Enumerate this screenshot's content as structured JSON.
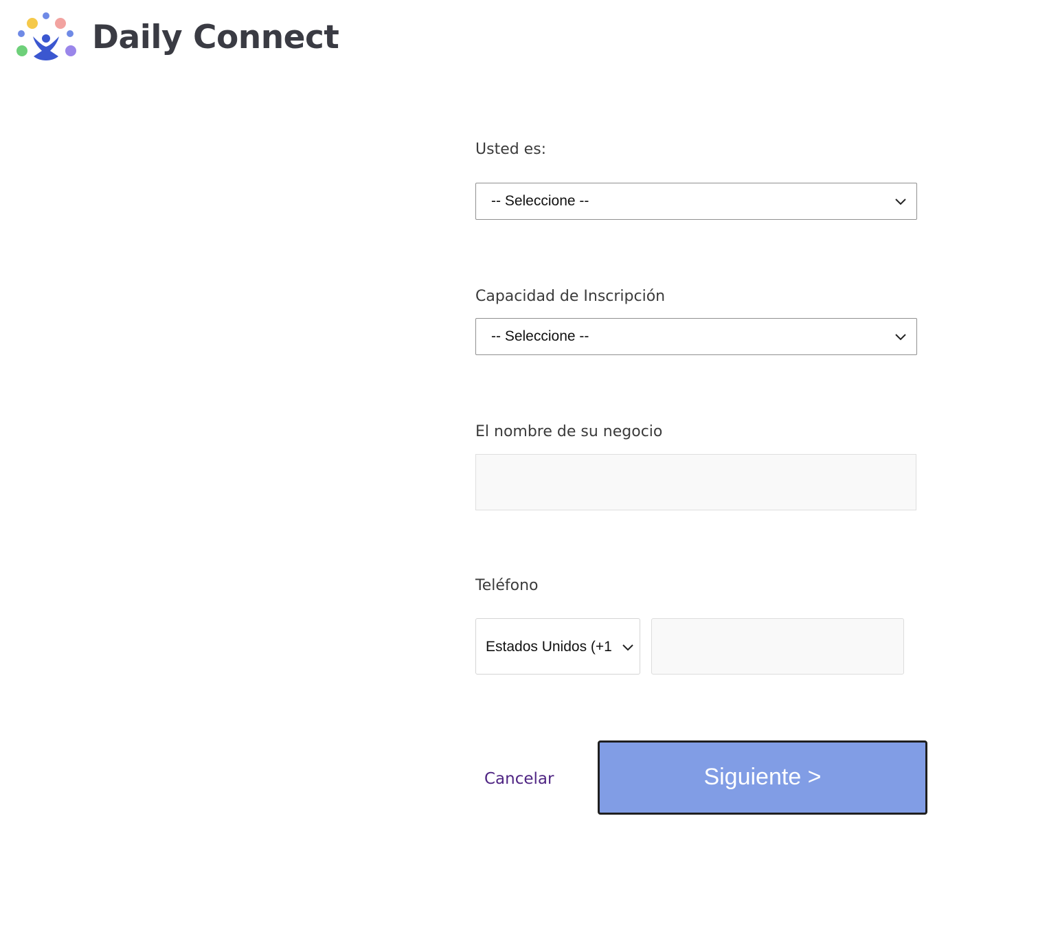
{
  "header": {
    "logo_text": "Daily Connect",
    "logo_icon": "people-circle-logo-icon"
  },
  "form": {
    "role": {
      "label": "Usted es:",
      "selected": "-- Seleccione --"
    },
    "capacity": {
      "label": "Capacidad de Inscripción",
      "selected": "-- Seleccione --"
    },
    "business_name": {
      "label": "El nombre de su negocio",
      "value": ""
    },
    "phone": {
      "label": "Teléfono",
      "country_selected": "Estados Unidos (+1",
      "value": ""
    }
  },
  "actions": {
    "cancel_label": "Cancelar",
    "next_label": "Siguiente >"
  },
  "colors": {
    "primary_button": "#819de5",
    "cancel_link": "#4f2583",
    "logo_text": "#3a3b43"
  }
}
